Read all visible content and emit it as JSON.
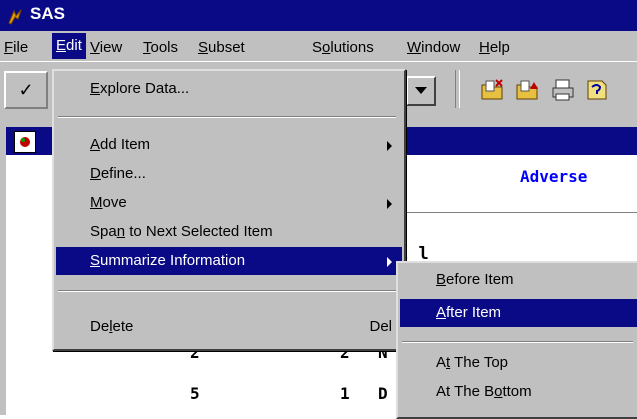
{
  "app": {
    "title": "SAS"
  },
  "menubar": [
    {
      "label": "File",
      "u": "F",
      "rest": "ile"
    },
    {
      "label": "Edit",
      "u": "E",
      "rest": "dit"
    },
    {
      "label": "View",
      "u": "V",
      "rest": "iew"
    },
    {
      "label": "Tools",
      "u": "T",
      "rest": "ools"
    },
    {
      "label": "Subset",
      "u": "S",
      "rest": "ubset"
    },
    {
      "label": "Solutions",
      "pre": "S",
      "u": "o",
      "rest": "lutions"
    },
    {
      "label": "Window",
      "u": "W",
      "rest": "indow"
    },
    {
      "label": "Help",
      "u": "H",
      "rest": "elp"
    }
  ],
  "toolbar": {
    "check_glyph": "✓"
  },
  "document": {
    "title_fragment": "",
    "report_title": "Adverse",
    "bold_fragment": "l l",
    "rows": [
      {
        "a": "2",
        "b": "2",
        "c": "N"
      },
      {
        "a": "5",
        "b": "1",
        "c": "D"
      }
    ]
  },
  "edit_menu": {
    "items": [
      {
        "pre": "",
        "u": "E",
        "rest": "xplore Data...",
        "acc": ""
      },
      {
        "pre": "",
        "u": "A",
        "rest": "dd Item",
        "acc": ""
      },
      {
        "pre": "",
        "u": "D",
        "rest": "efine...",
        "acc": ""
      },
      {
        "pre": "",
        "u": "M",
        "rest": "ove",
        "acc": ""
      },
      {
        "pre": "Spa",
        "u": "n",
        "rest": " to Next Selected Item",
        "acc": ""
      },
      {
        "pre": "",
        "u": "S",
        "rest": "ummarize Information",
        "acc": ""
      },
      {
        "pre": "De",
        "u": "l",
        "rest": "ete",
        "acc": "Del"
      }
    ]
  },
  "summarize_submenu": {
    "items": [
      {
        "pre": "",
        "u": "B",
        "rest": "efore Item"
      },
      {
        "pre": "",
        "u": "A",
        "rest": "fter Item"
      },
      {
        "pre": "A",
        "u": "t",
        "rest": " The Top"
      },
      {
        "pre": "At The B",
        "u": "o",
        "rest": "ttom"
      }
    ]
  },
  "colors": {
    "titlebar": "#0a0a86",
    "highlight": "#0a0a86",
    "chrome": "#c0c0c0",
    "report_title": "#0000ff"
  }
}
